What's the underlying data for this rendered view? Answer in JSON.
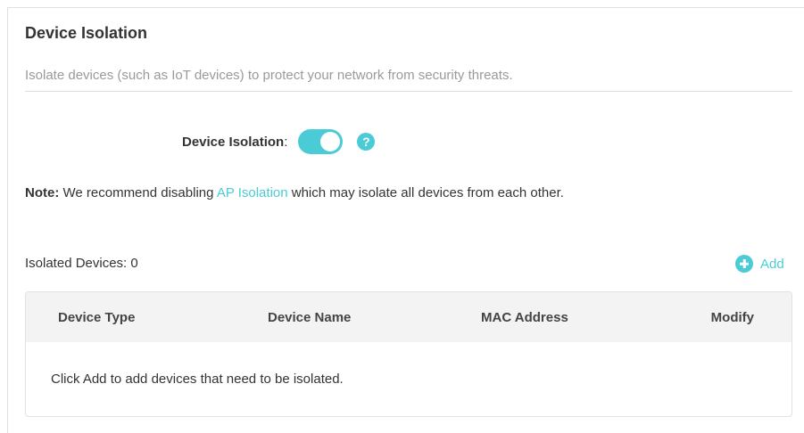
{
  "section": {
    "title": "Device Isolation",
    "description": "Isolate devices (such as IoT devices) to protect your network from security threats."
  },
  "isolation": {
    "label": "Device Isolation",
    "colon": ":",
    "enabled": true,
    "help_icon": "?"
  },
  "note": {
    "prefix": "Note:",
    "text_before": " We recommend disabling ",
    "link": "AP Isolation",
    "text_after": " which may isolate all devices from each other."
  },
  "list": {
    "count_label": "Isolated Devices: 0",
    "add_label": "Add"
  },
  "table": {
    "columns": [
      "Device Type",
      "Device Name",
      "MAC Address",
      "Modify"
    ],
    "empty_message": "Click Add to add devices that need to be isolated."
  },
  "colors": {
    "accent": "#4acbd6",
    "muted_text": "#9a9a9a",
    "header_bg": "#f3f3f3"
  }
}
